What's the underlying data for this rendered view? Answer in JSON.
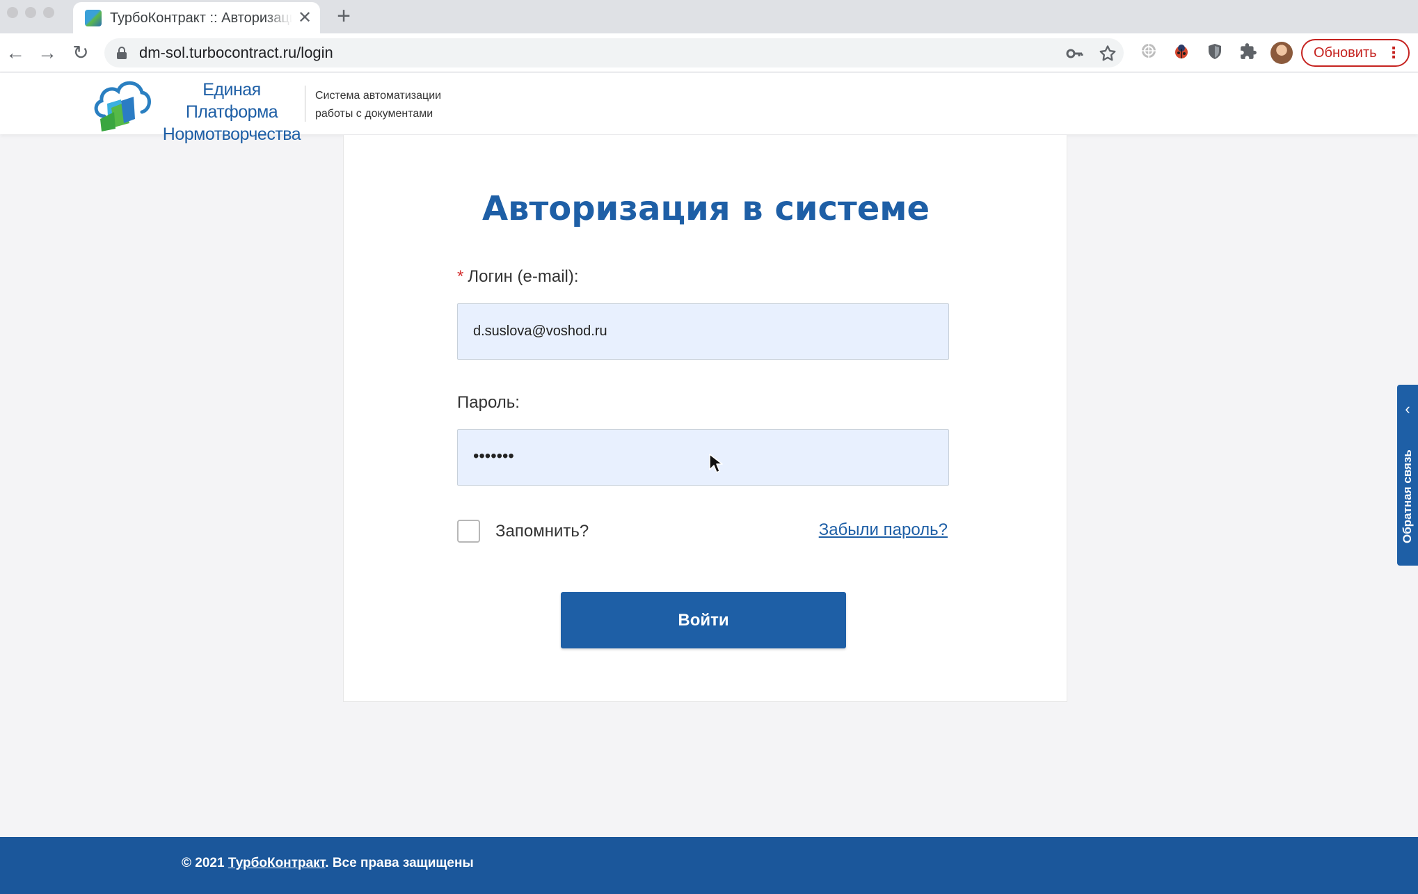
{
  "browser": {
    "tab_title": "ТурбоКонтракт :: Авторизация",
    "tab_close": "✕",
    "new_tab": "+",
    "url": "dm-sol.turbocontract.ru/login",
    "update_label": "Обновить",
    "update_menu": "⋮",
    "nav": {
      "back": "←",
      "forward": "→",
      "reload": "↻"
    },
    "icons": [
      "key-icon",
      "star-icon",
      "extension-globe-icon",
      "extension-ladybug-icon",
      "extension-shield-icon",
      "extensions-puzzle-icon",
      "profile-avatar"
    ]
  },
  "site": {
    "logo_title_line1": "Единая Платформа",
    "logo_title_line2": "Нормотворчества",
    "logo_subtitle_line1": "Система автоматизации",
    "logo_subtitle_line2": "работы с документами"
  },
  "login": {
    "title": "Авторизация в системе",
    "required_mark": "*",
    "email_label": "Логин (e-mail):",
    "email_value": "d.suslova@voshod.ru",
    "password_label": "Пароль:",
    "password_masked": "•••••••",
    "remember_label": "Запомнить?",
    "forgot_label": "Забыли пароль?",
    "submit_label": "Войти"
  },
  "feedback": {
    "chevron": "‹",
    "label": "Обратная связь"
  },
  "footer": {
    "copyright": "© 2021 ",
    "brand_link": "ТурбоКонтракт",
    "rights": ". Все права защищены"
  },
  "colors": {
    "brand_blue": "#1e5fa6",
    "footer_blue": "#1b579b",
    "input_bg": "#e8f0fe",
    "update_red": "#c5221f"
  }
}
